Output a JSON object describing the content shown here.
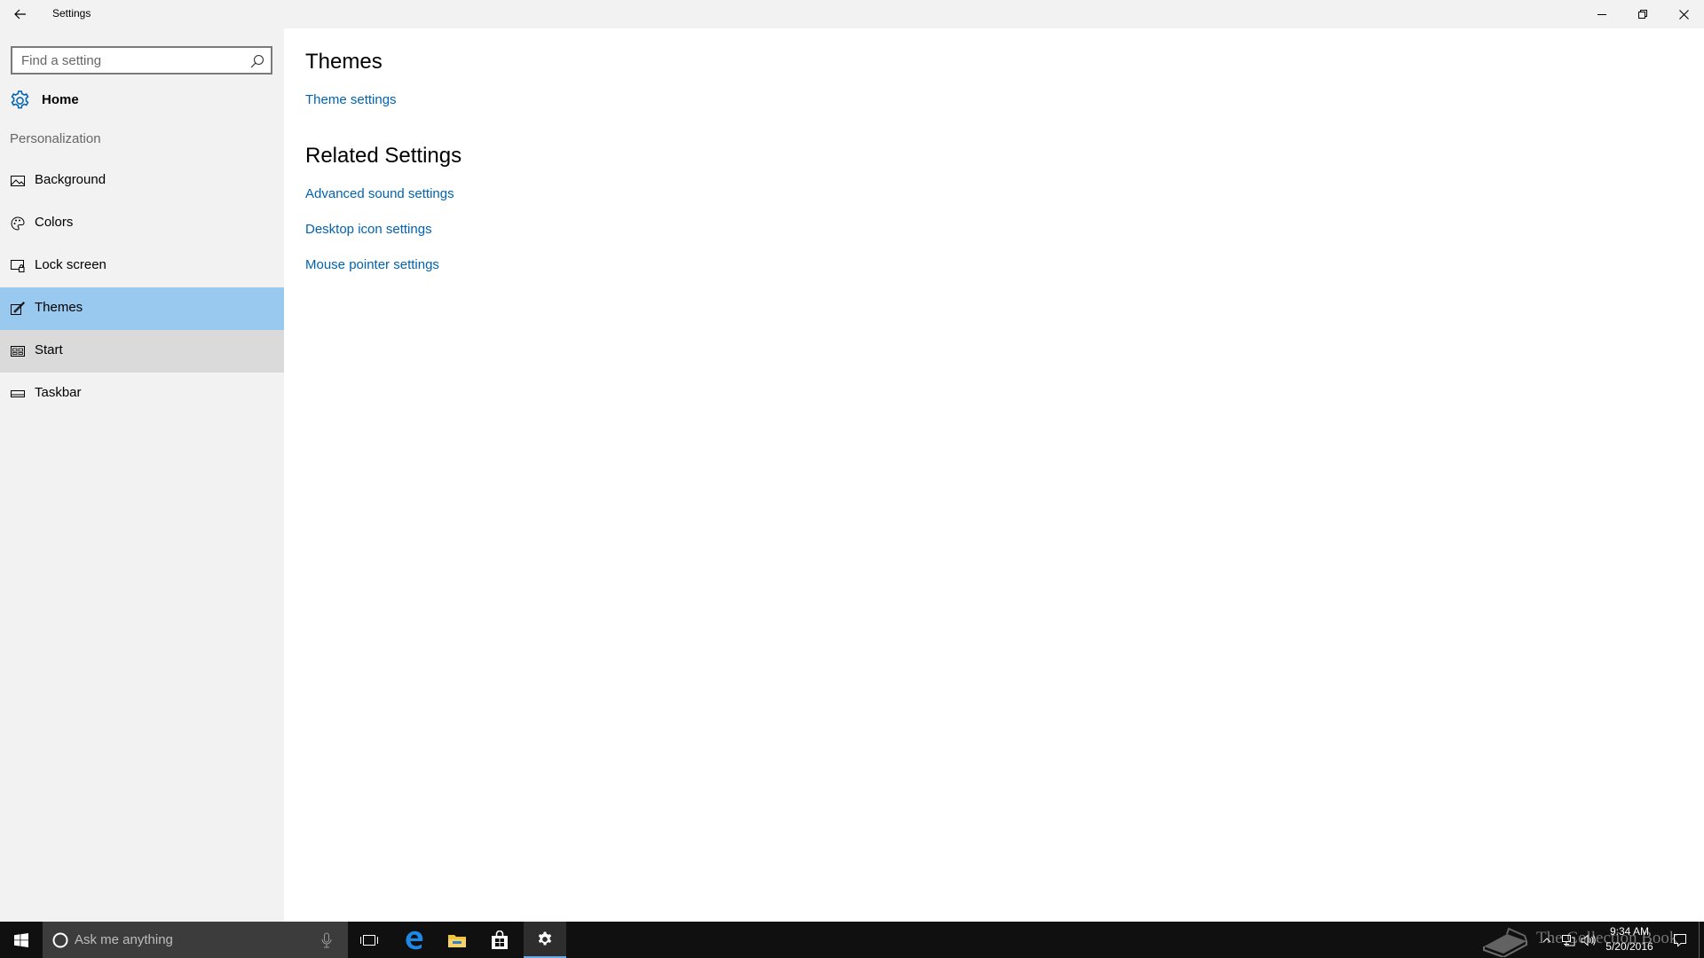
{
  "window": {
    "title": "Settings",
    "back_icon": "back-arrow-icon",
    "controls": [
      "minimize-icon",
      "restore-icon",
      "close-icon"
    ]
  },
  "sidebar": {
    "search_placeholder": "Find a setting",
    "search_value": "",
    "home_label": "Home",
    "section_label": "Personalization",
    "items": [
      {
        "label": "Background",
        "icon": "picture-icon"
      },
      {
        "label": "Colors",
        "icon": "palette-icon"
      },
      {
        "label": "Lock screen",
        "icon": "lock-screen-icon"
      },
      {
        "label": "Themes",
        "icon": "themes-icon",
        "state": "selected"
      },
      {
        "label": "Start",
        "icon": "start-grid-icon",
        "state": "hover"
      },
      {
        "label": "Taskbar",
        "icon": "taskbar-icon"
      }
    ]
  },
  "main": {
    "heading": "Themes",
    "theme_link": "Theme settings",
    "related_heading": "Related Settings",
    "related_links": [
      "Advanced sound settings",
      "Desktop icon settings",
      "Mouse pointer settings"
    ]
  },
  "taskbar": {
    "search_placeholder": "Ask me anything",
    "apps": [
      "task-view-icon",
      "edge-icon",
      "file-explorer-icon",
      "store-icon",
      "settings-gear-icon"
    ],
    "active_app": "settings-gear-icon",
    "tray_icons": [
      "chevron-up-icon",
      "network-icon",
      "volume-icon",
      "action-center-icon"
    ],
    "time": "9:34 AM",
    "date": "5/20/2016",
    "watermark": "The Collection Book"
  },
  "colors": {
    "accent": "#0063b1",
    "selected_bg": "#99c9ef",
    "hover_bg": "#dadada",
    "sidebar_bg": "#f2f2f2",
    "taskbar_bg": "#101010"
  }
}
